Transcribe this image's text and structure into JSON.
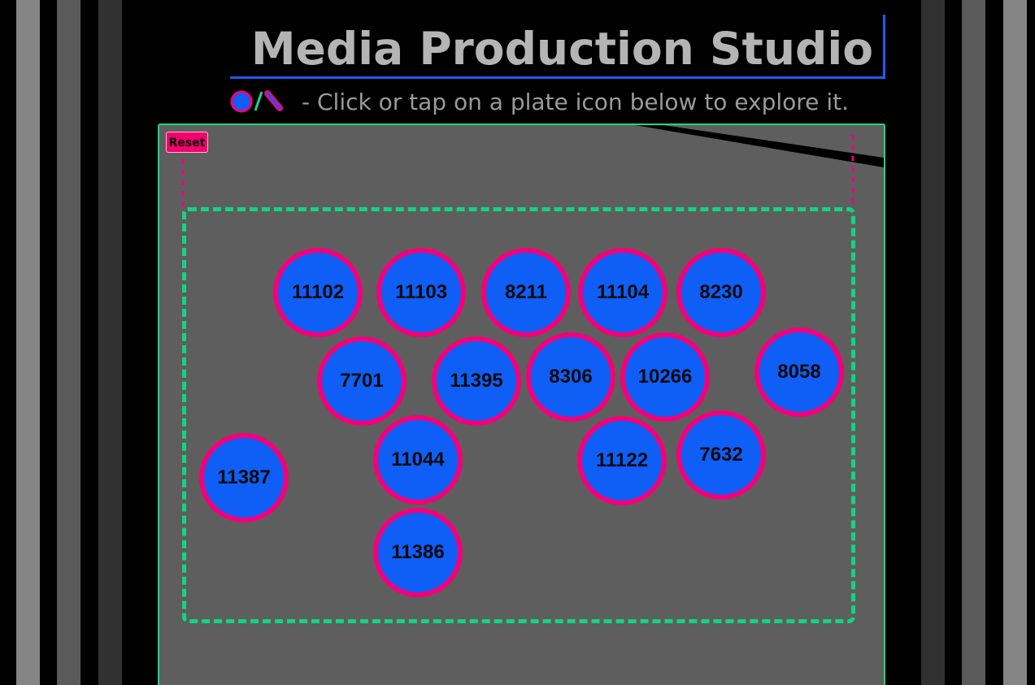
{
  "app": {
    "title": "Media Production Studio",
    "instruction": "- Click or tap on a plate icon below to explore it."
  },
  "legend": {
    "icons": [
      "plate-circle-icon",
      "slash-icon",
      "pill-icon"
    ]
  },
  "controls": {
    "reset_label": "Reset"
  },
  "plates": [
    {
      "id": "11102"
    },
    {
      "id": "11103"
    },
    {
      "id": "8211"
    },
    {
      "id": "11104"
    },
    {
      "id": "8230"
    },
    {
      "id": "7701"
    },
    {
      "id": "11395"
    },
    {
      "id": "8306"
    },
    {
      "id": "10266"
    },
    {
      "id": "8058"
    },
    {
      "id": "11387"
    },
    {
      "id": "11044"
    },
    {
      "id": "11122"
    },
    {
      "id": "7632"
    },
    {
      "id": "11386"
    }
  ],
  "colors": {
    "background": "#000000",
    "board": "#5e5e5e",
    "board_border": "#1fd58d",
    "drop_zone_border": "#12d38c",
    "plate_fill": "#0f5ef5",
    "plate_ring": "#f4007a",
    "accent_blue": "#1d5cf5",
    "reset_fill": "#f4006e",
    "title_text": "#b4b4b4",
    "hint_text": "#9a9a9a"
  }
}
